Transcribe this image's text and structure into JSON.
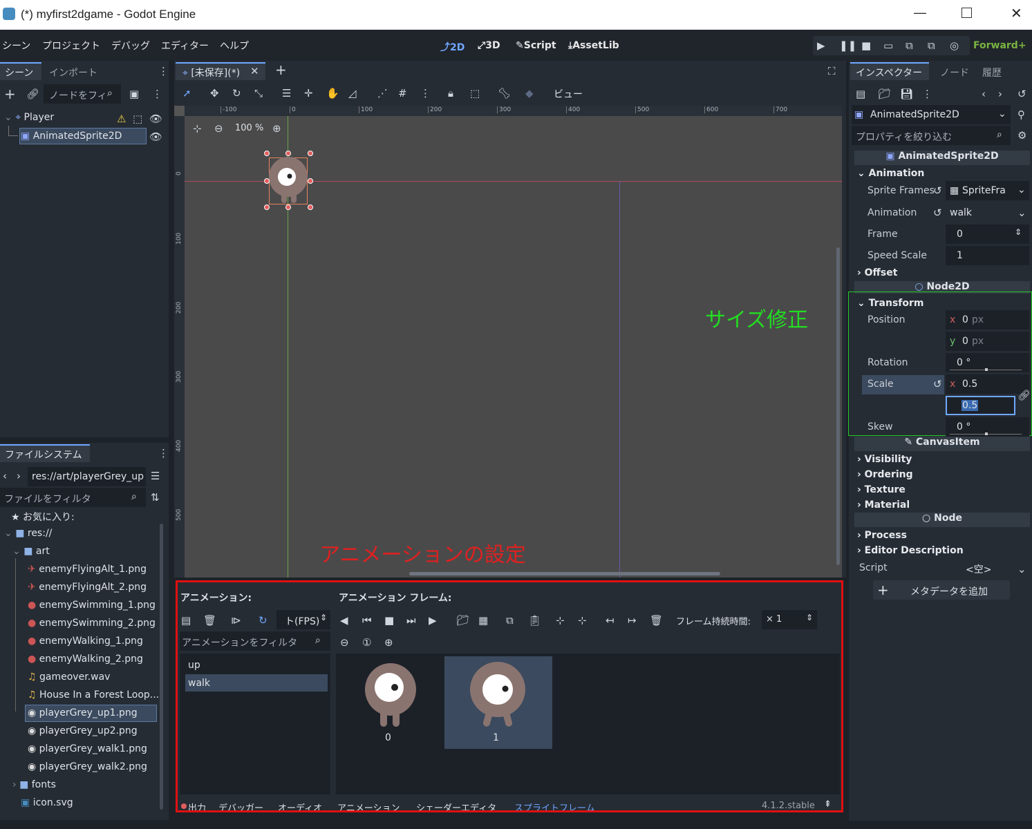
{
  "window": {
    "title": "(*) myfirst2dgame - Godot Engine"
  },
  "menu": [
    "シーン",
    "プロジェクト",
    "デバッグ",
    "エディター",
    "ヘルプ"
  ],
  "modes": [
    "2D",
    "3D",
    "Script",
    "AssetLib"
  ],
  "renderer": "Forward+",
  "scene_dock": {
    "tabs": [
      "シーン",
      "インポート"
    ],
    "filter_placeholder": "ノードをフィ",
    "nodes": [
      "Player",
      "AnimatedSprite2D"
    ]
  },
  "filesystem": {
    "title": "ファイルシステム",
    "path": "res://art/playerGrey_up",
    "filter_placeholder": "ファイルをフィルタ",
    "favorites": "お気に入り:",
    "root": "res://",
    "folder_art": "art",
    "files": [
      "enemyFlyingAlt_1.png",
      "enemyFlyingAlt_2.png",
      "enemySwimming_1.png",
      "enemySwimming_2.png",
      "enemyWalking_1.png",
      "enemyWalking_2.png",
      "gameover.wav",
      "House In a Forest Loop...",
      "playerGrey_up1.png",
      "playerGrey_up2.png",
      "playerGrey_walk1.png",
      "playerGrey_walk2.png"
    ],
    "folder_fonts": "fonts",
    "icon": "icon.svg"
  },
  "viewport": {
    "tab": "[未保存](*)",
    "zoom": "100 %",
    "view_label": "ビュー",
    "ruler_x": [
      "-100",
      "0",
      "100",
      "200",
      "300",
      "400",
      "500",
      "600",
      "700"
    ],
    "ruler_y": [
      "0",
      "100",
      "200",
      "300",
      "400",
      "500"
    ]
  },
  "annotations": {
    "size_fix": "サイズ修正",
    "anim_settings": "アニメーションの設定"
  },
  "sprite_frames": {
    "animations_label": "アニメーション:",
    "frames_label": "アニメーション フレーム:",
    "fps": "ト(FPS)",
    "filter_placeholder": "アニメーションをフィルタ",
    "animations": [
      "up",
      "walk"
    ],
    "frame_duration_label": "フレーム持続時間:",
    "frame_duration": "× 1",
    "frames": [
      "0",
      "1"
    ]
  },
  "bottom_tabs": [
    "出力",
    "デバッガー",
    "オーディオ",
    "アニメーション",
    "シェーダーエディタ",
    "スプライトフレーム"
  ],
  "version": "4.1.2.stable",
  "inspector": {
    "tabs": [
      "インスペクター",
      "ノード",
      "履歴"
    ],
    "object": "AnimatedSprite2D",
    "filter_placeholder": "プロパティを絞り込む",
    "class_header": "AnimatedSprite2D",
    "section_animation": "Animation",
    "sprite_frames_label": "Sprite Frames",
    "sprite_frames_value": "SpriteFra",
    "animation_label": "Animation",
    "animation_value": "walk",
    "frame_label": "Frame",
    "frame_value": "0",
    "speed_label": "Speed Scale",
    "speed_value": "1",
    "offset": "Offset",
    "node2d": "Node2D",
    "transform": "Transform",
    "position_label": "Position",
    "pos_x": "0",
    "pos_y": "0",
    "px": "px",
    "rotation_label": "Rotation",
    "rotation_value": "0 °",
    "scale_label": "Scale",
    "scale_x": "0.5",
    "scale_y": "0.5",
    "skew_label": "Skew",
    "skew_value": "0 °",
    "canvas_item": "CanvasItem",
    "visibility": "Visibility",
    "ordering": "Ordering",
    "texture": "Texture",
    "material": "Material",
    "node": "Node",
    "process": "Process",
    "editor_description": "Editor Description",
    "script_label": "Script",
    "script_value": "<空>",
    "add_metadata": "メタデータを追加"
  }
}
